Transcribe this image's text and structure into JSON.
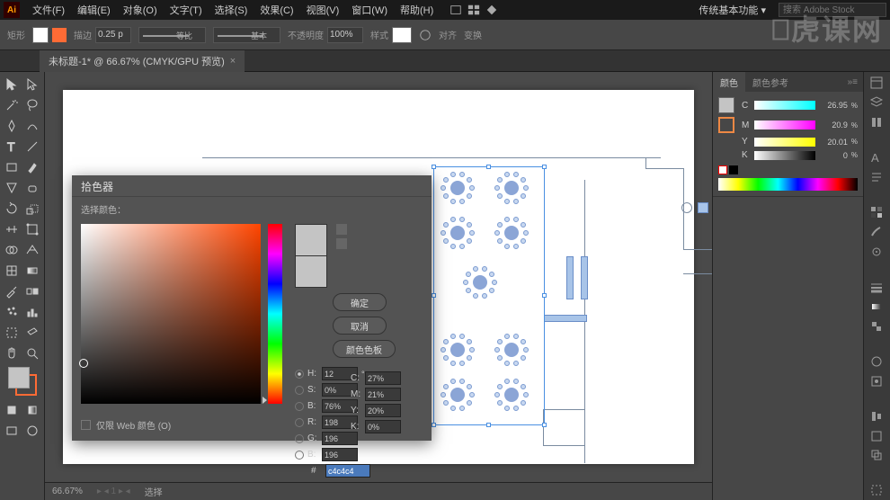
{
  "app": {
    "logo": "Ai"
  },
  "menu": {
    "file": "文件(F)",
    "edit": "编辑(E)",
    "object": "对象(O)",
    "type": "文字(T)",
    "select": "选择(S)",
    "effect": "效果(C)",
    "view": "视图(V)",
    "window": "窗口(W)",
    "help": "帮助(H)"
  },
  "workspace": "传统基本功能",
  "search_placeholder": "搜索 Adobe Stock",
  "control": {
    "tool_label": "矩形",
    "stroke_label": "描边",
    "stroke_val": "0.25 p",
    "uniform": "等比",
    "basic": "基本",
    "opacity_label": "不透明度",
    "opacity_val": "100%",
    "style_label": "样式",
    "align": "对齐",
    "transform": "变换"
  },
  "document": {
    "tab": "未标题-1* @ 66.67% (CMYK/GPU 预览)",
    "close": "×"
  },
  "status": {
    "zoom": "66.67%",
    "mode": "选择"
  },
  "panel_color": {
    "tab1": "颜色",
    "tab2": "颜色参考",
    "c_label": "C",
    "c_val": "26.95",
    "m_label": "M",
    "m_val": "20.9",
    "y_label": "Y",
    "y_val": "20.01",
    "k_label": "K",
    "k_val": "0"
  },
  "color_picker": {
    "title": "拾色器",
    "select_label": "选择颜色：",
    "ok": "确定",
    "cancel": "取消",
    "swatches": "颜色色板",
    "h_label": "H:",
    "h_val": "12",
    "h_unit": "°",
    "s_label": "S:",
    "s_val": "0%",
    "b_label": "B:",
    "b_val": "76%",
    "r_label": "R:",
    "r_val": "198",
    "g_label": "G:",
    "g_val": "196",
    "bl_label": "B:",
    "bl_val": "196",
    "c_label": "C:",
    "c_val": "27%",
    "m_label": "M:",
    "m_val": "21%",
    "y_label": "Y:",
    "y_val": "20%",
    "k_label": "K:",
    "k_val": "0%",
    "hex_val": "c4c4c4",
    "web_only": "仅限 Web 颜色 (O)"
  },
  "chart_data": null
}
